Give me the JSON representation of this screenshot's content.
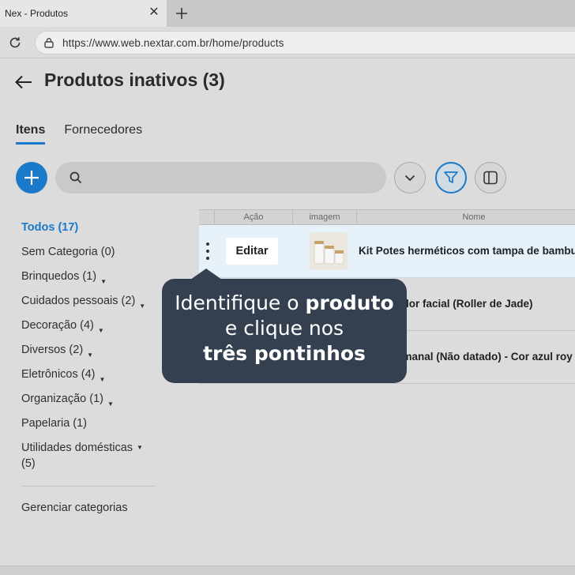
{
  "browser": {
    "tab_title": "Nex - Produtos",
    "url": "https://www.web.nextar.com.br/home/products",
    "icons": [
      "close-icon",
      "plus-icon",
      "reload-icon",
      "site-settings-icon"
    ]
  },
  "header": {
    "title": "Produtos inativos",
    "count": "(3)"
  },
  "tabs": [
    {
      "label": "Itens",
      "active": true
    },
    {
      "label": "Fornecedores",
      "active": false
    }
  ],
  "toolbar": {
    "search_placeholder": "",
    "accent_color": "#1a7ac9"
  },
  "sidebar": {
    "categories": [
      {
        "label": "Todos (17)",
        "active": true,
        "has_caret": false
      },
      {
        "label": "Sem Categoria (0)",
        "active": false,
        "has_caret": false
      },
      {
        "label": "Brinquedos (1)",
        "active": false,
        "has_caret": true
      },
      {
        "label": "Cuidados pessoais (2)",
        "active": false,
        "has_caret": true
      },
      {
        "label": "Decoração (4)",
        "active": false,
        "has_caret": true
      },
      {
        "label": "Diversos (2)",
        "active": false,
        "has_caret": true
      },
      {
        "label": "Eletrônicos (4)",
        "active": false,
        "has_caret": true
      },
      {
        "label": "Organização (1)",
        "active": false,
        "has_caret": true
      },
      {
        "label": "Papelaria (1)",
        "active": false,
        "has_caret": false
      }
    ],
    "last_category": {
      "label_line1": "Utilidades domésticas",
      "label_line2": "(5)"
    },
    "manage_label": "Gerenciar categorias"
  },
  "table": {
    "columns": [
      "Ação",
      "imagem",
      "Nome"
    ],
    "rows": [
      {
        "name": "Kit Potes herméticos com tampa de bambu",
        "edit_label": "Editar"
      },
      {
        "name": "ador facial (Roller de Jade)"
      },
      {
        "name": "emanal (Não datado) - Cor azul roy"
      }
    ]
  },
  "tooltip": {
    "line1_a": "Identifique o ",
    "line1_b": "produto",
    "line2": "e clique nos",
    "line3": "três pontinhos"
  }
}
